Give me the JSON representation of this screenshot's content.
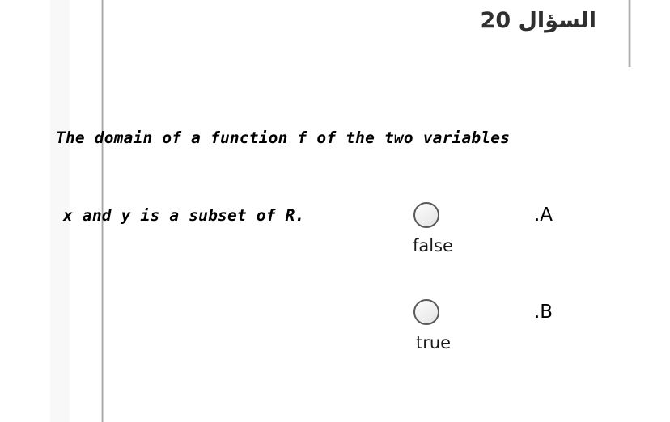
{
  "header": {
    "question_title": "السؤال 20"
  },
  "statement": {
    "line1": "The domain of a function f of the two variables",
    "line2": "x and y is a subset of R."
  },
  "options": [
    {
      "letter": ".A",
      "value": "false",
      "selected": false,
      "radio_icon": "radio-unchecked-icon"
    },
    {
      "letter": ".B",
      "value": "true",
      "selected": false,
      "radio_icon": "radio-unchecked-icon"
    }
  ],
  "colors": {
    "page_background": "#ffffff",
    "title_text": "#2f2f2f",
    "body_text": "#000000",
    "rule": "#9a9a9a",
    "margin_band": "#f8f8f8",
    "radio_border": "#595959",
    "radio_fill": "#f2f2f2"
  }
}
